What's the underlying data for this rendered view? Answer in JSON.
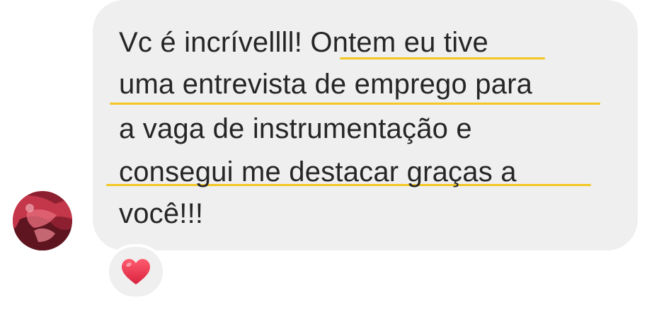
{
  "message": {
    "lines": [
      "Vc é incrívellll! Ontem eu tive",
      "uma entrevista de emprego para",
      "a vaga de instrumentação e",
      "consegui me destacar graças a",
      "você!!!"
    ],
    "highlight_color": "#f3c623",
    "bubble_color": "#efefef",
    "text_color": "#262626"
  },
  "sender": {
    "avatar_icon": "avatar"
  },
  "reaction": {
    "icon": "heart-icon",
    "color": "#e8364c"
  }
}
